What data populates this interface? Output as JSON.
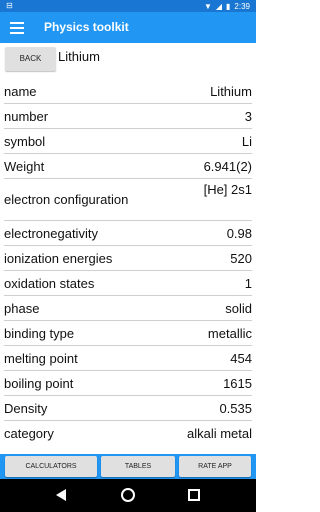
{
  "status_bar": {
    "left_icon": "notification-icon",
    "time": "2:39"
  },
  "app_bar": {
    "title": "Physics toolkit"
  },
  "subheader": {
    "back_label": "BACK",
    "element_name": "Lithium"
  },
  "properties": [
    {
      "key": "name",
      "value": "Lithium"
    },
    {
      "key": "number",
      "value": "3"
    },
    {
      "key": "symbol",
      "value": "Li"
    },
    {
      "key": "Weight",
      "value": "6.941(2)"
    },
    {
      "key": "electron configuration",
      "value": "[He] 2s1"
    },
    {
      "key": "electronegativity",
      "value": "0.98"
    },
    {
      "key": "ionization energies",
      "value": "520"
    },
    {
      "key": "oxidation states",
      "value": "1"
    },
    {
      "key": "phase",
      "value": "solid"
    },
    {
      "key": "binding type",
      "value": "metallic"
    },
    {
      "key": "melting point",
      "value": "454"
    },
    {
      "key": "boiling point",
      "value": "1615"
    },
    {
      "key": "Density",
      "value": "0.535"
    },
    {
      "key": "category",
      "value": "alkali metal"
    }
  ],
  "bottom_buttons": {
    "calculators": "CALCULATORS",
    "tables": "TABLES",
    "rate": "RATE APP"
  },
  "colors": {
    "status_bar": "#1976d2",
    "app_bar": "#2196f3",
    "button": "#e0e0e0"
  }
}
